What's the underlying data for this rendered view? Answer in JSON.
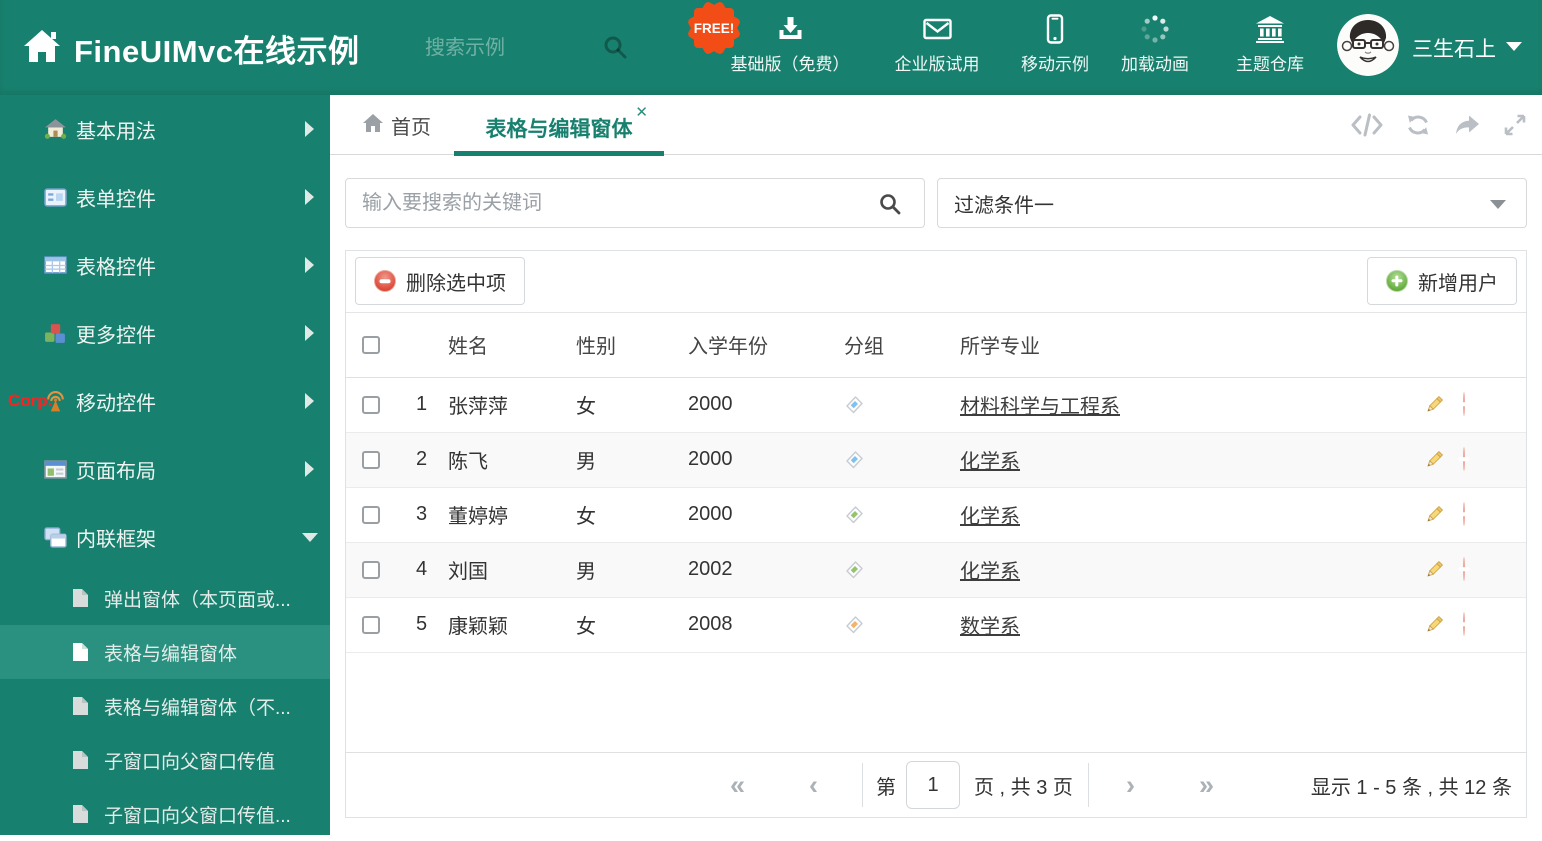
{
  "theme": {
    "teal": "#18806e",
    "teal_selected": "#2a9180",
    "badge_orange": "#f24d16",
    "delete_red": "#dc4937",
    "add_green": "#64ad3e"
  },
  "header": {
    "title": "FineUIMvc在线示例",
    "search_placeholder": "搜索示例",
    "free_badge": "FREE!",
    "nav": [
      {
        "label": "基础版（免费）",
        "icon": "download-icon"
      },
      {
        "label": "企业版试用",
        "icon": "envelope-icon"
      },
      {
        "label": "移动示例",
        "icon": "mobile-icon"
      },
      {
        "label": "加载动画",
        "icon": "spinner-icon"
      },
      {
        "label": "主题仓库",
        "icon": "bank-icon"
      }
    ],
    "user_name": "三生石上"
  },
  "sidebar": {
    "items": [
      {
        "label": "基本用法"
      },
      {
        "label": "表单控件"
      },
      {
        "label": "表格控件"
      },
      {
        "label": "更多控件"
      },
      {
        "label": "移动控件",
        "badge": "Corp."
      },
      {
        "label": "页面布局"
      },
      {
        "label": "内联框架"
      }
    ],
    "subitems": [
      {
        "label": "弹出窗体（本页面或..."
      },
      {
        "label": "表格与编辑窗体"
      },
      {
        "label": "表格与编辑窗体（不..."
      },
      {
        "label": "子窗口向父窗口传值"
      },
      {
        "label": "子窗口向父窗口传值..."
      }
    ]
  },
  "tabs": {
    "home": "首页",
    "active": "表格与编辑窗体",
    "close_glyph": "✕"
  },
  "filters": {
    "search_placeholder": "输入要搜索的关键词",
    "filter_value": "过滤条件一"
  },
  "grid": {
    "delete_button": "删除选中项",
    "add_button": "新增用户",
    "columns": [
      "姓名",
      "性别",
      "入学年份",
      "分组",
      "所学专业"
    ],
    "rows": [
      {
        "num": "1",
        "name": "张萍萍",
        "gender": "女",
        "year": "2000",
        "tag_hex": "#7fc1ef",
        "major": "材料科学与工程系"
      },
      {
        "num": "2",
        "name": "陈飞",
        "gender": "男",
        "year": "2000",
        "tag_hex": "#7fc1ef",
        "major": "化学系"
      },
      {
        "num": "3",
        "name": "董婷婷",
        "gender": "女",
        "year": "2000",
        "tag_hex": "#93c36b",
        "major": "化学系"
      },
      {
        "num": "4",
        "name": "刘国",
        "gender": "男",
        "year": "2002",
        "tag_hex": "#93c36b",
        "major": "化学系"
      },
      {
        "num": "5",
        "name": "康颖颖",
        "gender": "女",
        "year": "2008",
        "tag_hex": "#f5b26b",
        "major": "数学系"
      }
    ],
    "pagination": {
      "first_glyph": "«",
      "prev_glyph": "‹",
      "page_prefix": "第",
      "page_value": "1",
      "page_suffix": "页 , 共 3 页",
      "next_glyph": "›",
      "last_glyph": "»",
      "summary": "显示 1 - 5 条 , 共 12 条"
    }
  }
}
